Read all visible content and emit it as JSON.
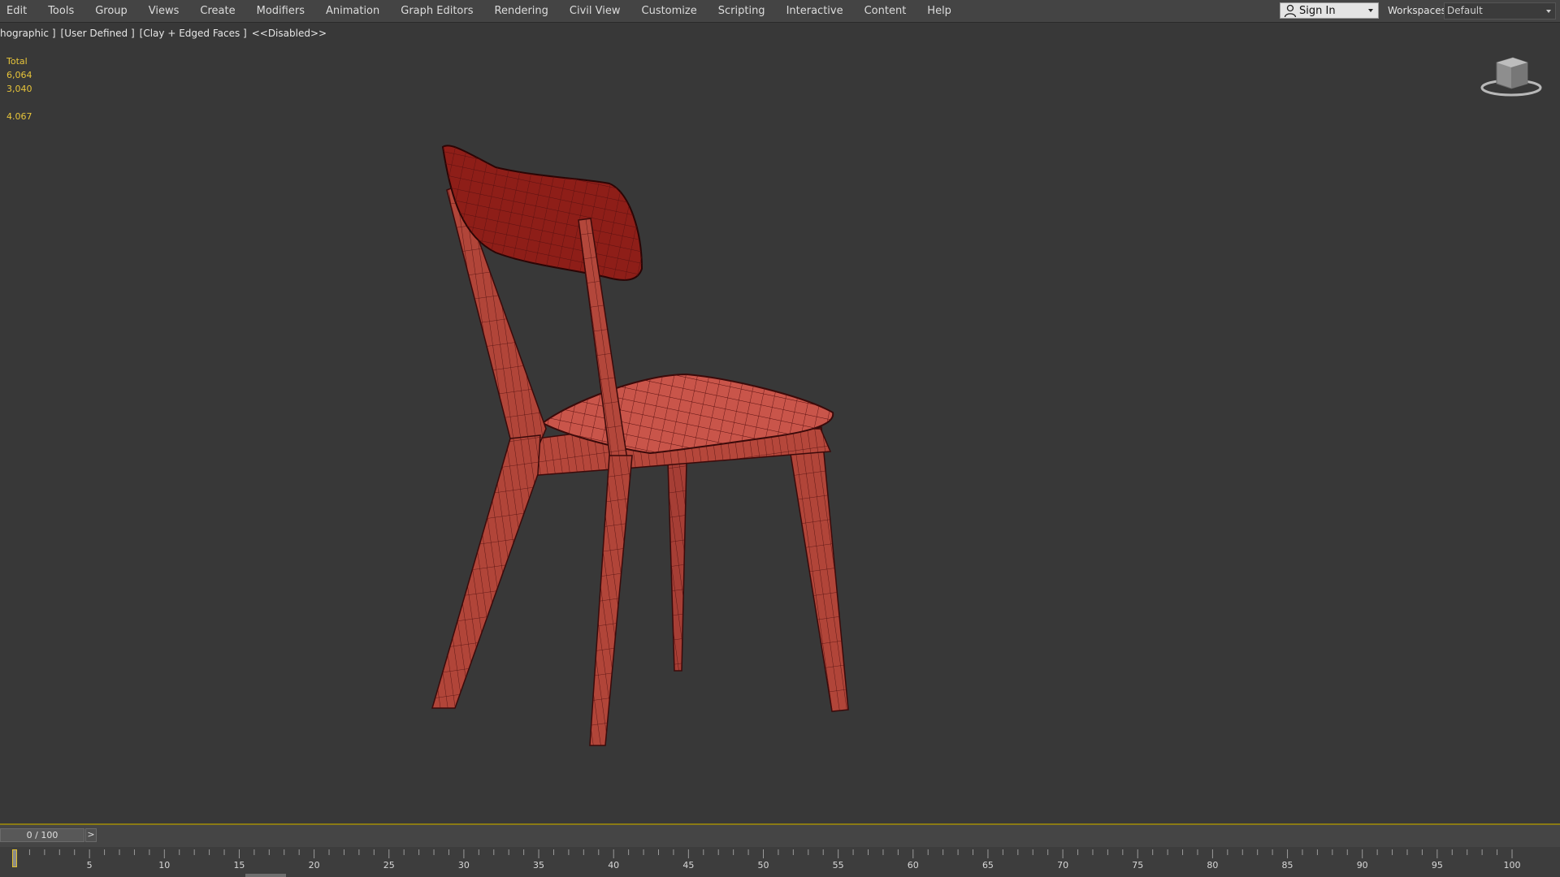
{
  "menu": {
    "items": [
      "Edit",
      "Tools",
      "Group",
      "Views",
      "Create",
      "Modifiers",
      "Animation",
      "Graph Editors",
      "Rendering",
      "Civil View",
      "Customize",
      "Scripting",
      "Interactive",
      "Content",
      "Help"
    ]
  },
  "account": {
    "signin_label": "Sign In",
    "icon": "user-icon"
  },
  "workspace": {
    "label": "Workspaces:",
    "value": "Default"
  },
  "viewport": {
    "labels": [
      "hographic ]",
      "[User Defined ]",
      "[Clay + Edged Faces ]",
      "<<Disabled>>"
    ],
    "stats": [
      "Total",
      "6,064",
      "3,040",
      "",
      "4.067"
    ],
    "stats_color": "#e8c53a",
    "background": "#383838",
    "object_color": "#b84a3e",
    "object_wire_color": "#5a1010"
  },
  "timeline": {
    "slider_text": "0 / 100",
    "next_label": ">",
    "ticks": [
      "5",
      "10",
      "15",
      "20",
      "25",
      "30",
      "35",
      "40",
      "45",
      "50",
      "55",
      "60",
      "65",
      "70",
      "75",
      "80",
      "85",
      "90",
      "95",
      "100"
    ],
    "current_frame": 0,
    "total_frames": 100
  }
}
